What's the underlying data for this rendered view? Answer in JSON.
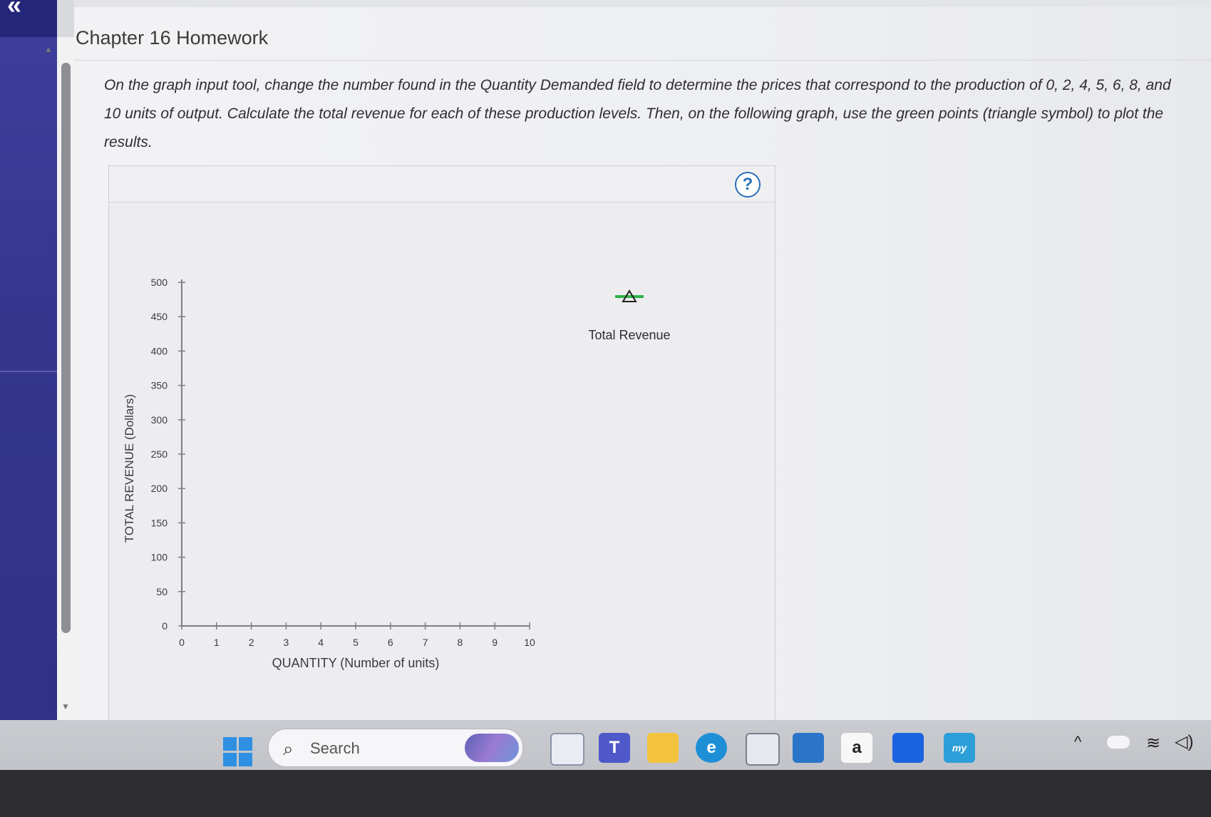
{
  "page": {
    "title": "Chapter 16 Homework",
    "instructions": "On the graph input tool, change the number found in the Quantity Demanded field to determine the prices that correspond to the production of 0, 2, 4, 5, 6, 8, and 10 units of output. Calculate the total revenue for each of these production levels. Then, on the following graph, use the green points (triangle symbol) to plot the results.",
    "help_label": "?"
  },
  "chart_data": {
    "type": "scatter",
    "xlabel": "QUANTITY (Number of units)",
    "ylabel": "TOTAL REVENUE (Dollars)",
    "xlim": [
      0,
      10
    ],
    "ylim": [
      0,
      500
    ],
    "x_ticks": [
      "0",
      "1",
      "2",
      "3",
      "4",
      "5",
      "6",
      "7",
      "8",
      "9",
      "10"
    ],
    "y_ticks": [
      "0",
      "50",
      "100",
      "150",
      "200",
      "250",
      "300",
      "350",
      "400",
      "450",
      "500"
    ],
    "legend": {
      "label": "Total Revenue",
      "symbol": "triangle",
      "color": "#2db34a",
      "placement": "right"
    },
    "series": [
      {
        "name": "Total Revenue",
        "points": []
      }
    ],
    "grid": false
  },
  "taskbar": {
    "search_placeholder": "Search",
    "icons": [
      {
        "name": "task-view-icon",
        "glyph": ""
      },
      {
        "name": "teams-icon",
        "glyph": "T"
      },
      {
        "name": "file-explorer-icon",
        "glyph": ""
      },
      {
        "name": "edge-icon",
        "glyph": "e"
      },
      {
        "name": "store-icon",
        "glyph": ""
      },
      {
        "name": "mail-icon",
        "glyph": ""
      },
      {
        "name": "amazon-icon",
        "glyph": "a"
      },
      {
        "name": "dropbox-icon",
        "glyph": ""
      },
      {
        "name": "mylab-icon",
        "glyph": "my"
      }
    ],
    "colors": {
      "accent": "#2f90e3",
      "edge": "#1e8fd6",
      "teams": "#5059c9",
      "explorer": "#f3c33d"
    }
  }
}
